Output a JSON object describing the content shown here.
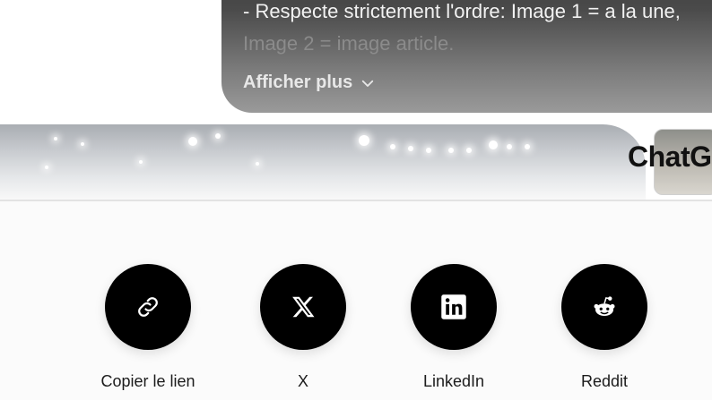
{
  "message": {
    "line1": "- Respecte strictement l'ordre: Image 1 = a la une,",
    "line2": "Image 2 = image article.",
    "show_more_label": "Afficher plus",
    "show_more_icon": "chevron-down-icon"
  },
  "header": {
    "brand": "ChatG"
  },
  "share": {
    "items": [
      {
        "label": "Copier le lien",
        "icon": "link-icon"
      },
      {
        "label": "X",
        "icon": "x-icon"
      },
      {
        "label": "LinkedIn",
        "icon": "linkedin-icon"
      },
      {
        "label": "Reddit",
        "icon": "reddit-icon"
      }
    ]
  },
  "colors": {
    "button_bg": "#000000",
    "icon_fg": "#ffffff"
  }
}
